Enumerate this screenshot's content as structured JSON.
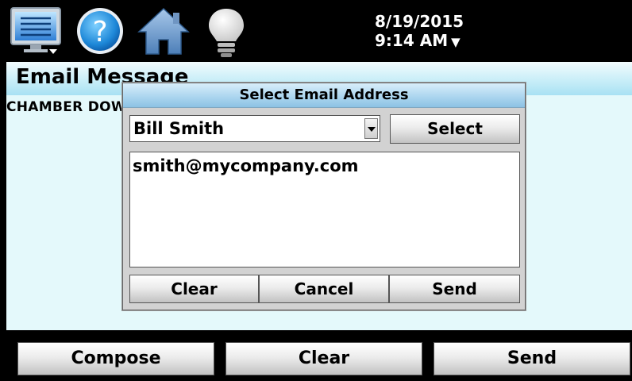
{
  "toolbar": {
    "icons": [
      "monitor-icon",
      "help-icon",
      "home-icon",
      "light-bulb-icon"
    ]
  },
  "clock": {
    "date": "8/19/2015",
    "time": "9:14 AM",
    "arrow": "▼"
  },
  "page": {
    "title": "Email Message",
    "subject": "CHAMBER DOWN"
  },
  "dialog": {
    "title": "Select Email Address",
    "recipient": "Bill Smith",
    "select_label": "Select",
    "address": "smith@mycompany.com",
    "clear_label": "Clear",
    "cancel_label": "Cancel",
    "send_label": "Send"
  },
  "bottom": {
    "compose_label": "Compose",
    "clear_label": "Clear",
    "send_label": "Send"
  },
  "colors": {
    "title_gradient": "#a8e1f3",
    "main_bg": "#e4f9fb",
    "dialog_bg": "#d2d2d2",
    "dialog_header": "#8cc2e4"
  }
}
